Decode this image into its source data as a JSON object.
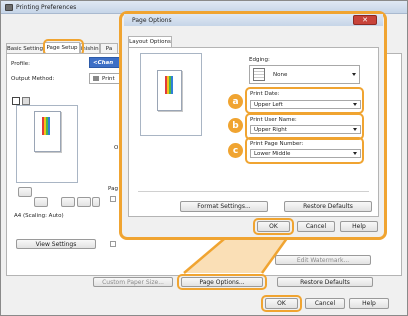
{
  "main_window": {
    "title": "Printing Preferences",
    "tabs": [
      "Basic Setting",
      "Page Setup",
      "Finishing",
      "Pa"
    ],
    "profile_label": "Profile:",
    "profile_value": "<Chan",
    "output_method_label": "Output Method:",
    "output_method_value": "Print",
    "page_size_caption": "A4 (Scaling: Auto)",
    "view_settings_label": "View Settings",
    "edit_watermark_label": "Edit Watermark...",
    "custom_paper_size_label": "Custom Paper Size...",
    "page_options_label": "Page Options...",
    "restore_defaults_label": "Restore Defaults",
    "ok_label": "OK",
    "cancel_label": "Cancel",
    "help_label": "Help",
    "partial_label_pag": "Pag",
    "partial_label_o": "O"
  },
  "dialog": {
    "title": "Page Options",
    "tab_label": "Layout Options",
    "edging_label": "Edging:",
    "edging_value": "None",
    "print_date_label": "Print Date:",
    "print_date_value": "Upper Left",
    "print_user_name_label": "Print User Name:",
    "print_user_name_value": "Upper Right",
    "print_page_number_label": "Print Page Number:",
    "print_page_number_value": "Lower Middle",
    "format_settings_label": "Format Settings...",
    "restore_defaults_label": "Restore Defaults",
    "ok_label": "OK",
    "cancel_label": "Cancel",
    "help_label": "Help"
  },
  "callouts": {
    "a": "a",
    "b": "b",
    "c": "c"
  },
  "colors": {
    "accent_orange": "#f0a431",
    "close_red": "#c8433a",
    "titlebar_blue": "#cfdcec"
  }
}
